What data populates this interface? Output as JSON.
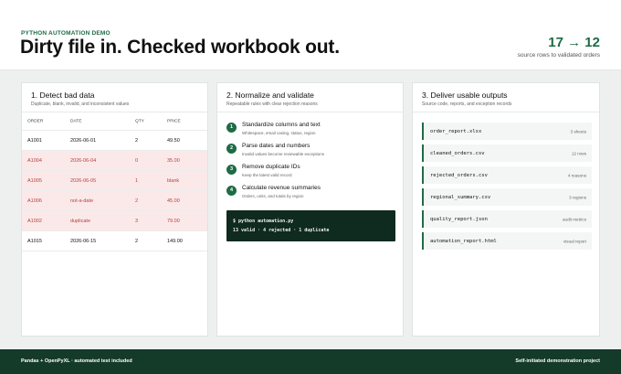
{
  "header": {
    "eyebrow": "PYTHON AUTOMATION DEMO",
    "title": "Dirty file in. Checked workbook out.",
    "stat": "17 → 12",
    "stat_sub": "source rows to validated orders"
  },
  "detect": {
    "title": "1. Detect bad data",
    "subtitle": "Duplicate, blank, invalid, and inconsistent values",
    "columns": [
      "ORDER",
      "DATE",
      "QTY",
      "PRICE"
    ],
    "rows": [
      {
        "order": "A1001",
        "date": "2026-06-01",
        "qty": "2",
        "price": "49.50",
        "status": "valid"
      },
      {
        "order": "A1004",
        "date": "2026-06-04",
        "qty": "0",
        "price": "35.00",
        "status": "bad"
      },
      {
        "order": "A1005",
        "date": "2026-06-05",
        "qty": "1",
        "price": "blank",
        "status": "bad"
      },
      {
        "order": "A1006",
        "date": "not-a-date",
        "qty": "2",
        "price": "45.00",
        "status": "bad"
      },
      {
        "order": "A1002",
        "date": "duplicate",
        "qty": "3",
        "price": "79.00",
        "status": "bad"
      },
      {
        "order": "A1015",
        "date": "2026-06-15",
        "qty": "2",
        "price": "149.00",
        "status": "valid"
      }
    ]
  },
  "normalize": {
    "title": "2. Normalize and validate",
    "subtitle": "Repeatable rules with clear rejection reasons",
    "steps": [
      {
        "num": "1",
        "title": "Standardize columns and text",
        "sub": "Whitespace, email casing, status, region"
      },
      {
        "num": "2",
        "title": "Parse dates and numbers",
        "sub": "Invalid values become reviewable exceptions"
      },
      {
        "num": "3",
        "title": "Remove duplicate IDs",
        "sub": "Keep the latest valid record"
      },
      {
        "num": "4",
        "title": "Calculate revenue summaries",
        "sub": "Orders, units, and totals by region"
      }
    ],
    "terminal": {
      "command": "$ python automation.py",
      "result": "13 valid · 4 rejected · 1 duplicate"
    }
  },
  "deliver": {
    "title": "3. Deliver usable outputs",
    "subtitle": "Source code, reports, and exception records",
    "files": [
      {
        "name": "order_report.xlsx",
        "meta": "3 sheets"
      },
      {
        "name": "cleaned_orders.csv",
        "meta": "12 rows"
      },
      {
        "name": "rejected_orders.csv",
        "meta": "4 reasons"
      },
      {
        "name": "regional_summary.csv",
        "meta": "3 regions"
      },
      {
        "name": "quality_report.json",
        "meta": "audit metrics"
      },
      {
        "name": "automation_report.html",
        "meta": "visual report"
      }
    ]
  },
  "footer": {
    "left": "Pandas + OpenPyXL · automated test included",
    "right": "Self-initiated demonstration project"
  },
  "colors": {
    "accent": "#1e6b45",
    "bad_row_bg": "#fbe9e9",
    "bad_row_text": "#b34040",
    "footer_bg": "#143a2a"
  }
}
